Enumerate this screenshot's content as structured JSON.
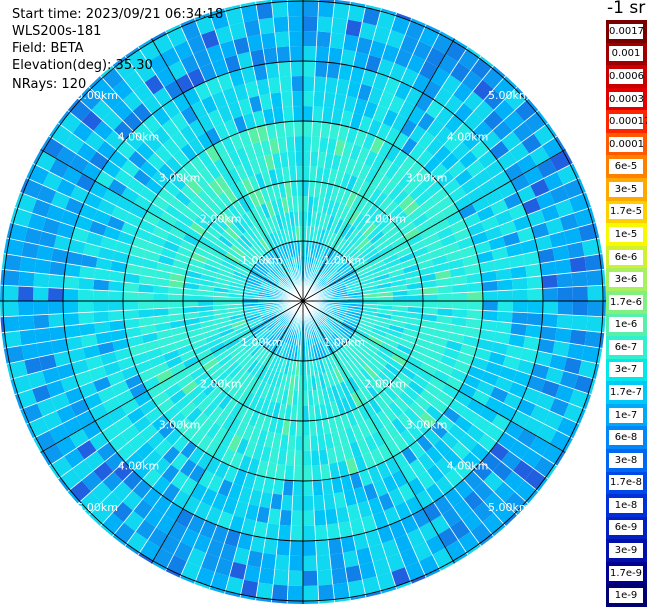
{
  "info": {
    "start_time": "Start time: 2023/09/21 06:34:18",
    "instrument": "WLS200s-181",
    "field": "Field: BETA",
    "elevation": "Elevation(deg): 35.30",
    "nrays": "NRays: 120"
  },
  "colorbar": {
    "title": "-1 sr",
    "labels": [
      "0.0017",
      "0.001",
      "0.0006",
      "0.0003",
      "0.00017",
      "0.0001",
      "6e-5",
      "3e-5",
      "1.7e-5",
      "1e-5",
      "6e-6",
      "3e-6",
      "1.7e-6",
      "1e-6",
      "6e-7",
      "3e-7",
      "1.7e-7",
      "1e-7",
      "6e-8",
      "3e-8",
      "1.7e-8",
      "1e-8",
      "6e-9",
      "3e-9",
      "1.7e-9",
      "1e-9"
    ],
    "colors": [
      "#7a0000",
      "#9e0000",
      "#c80000",
      "#e10000",
      "#ff2400",
      "#ff5a00",
      "#ff8000",
      "#ffa800",
      "#ffd000",
      "#f8f800",
      "#d0f030",
      "#a8f060",
      "#80f080",
      "#58f0a8",
      "#30f0d0",
      "#00e8e8",
      "#00c8f8",
      "#00a8f8",
      "#0088f8",
      "#0068f0",
      "#0048e8",
      "#0030d8",
      "#0020c0",
      "#0010a8",
      "#000090",
      "#000070"
    ]
  },
  "chart_data": {
    "type": "heatmap",
    "projection": "polar (PPI scan)",
    "field": "BETA",
    "unit": "sr-1",
    "elevation_deg": 35.3,
    "n_rays": 120,
    "range_rings_km": [
      1,
      2,
      3,
      4,
      5
    ],
    "range_ring_labels": [
      "1.00km",
      "2.00km",
      "3.00km",
      "4.00km",
      "5.00km"
    ],
    "azimuth_spokes_deg": [
      0,
      30,
      60,
      90,
      120,
      150,
      180,
      210,
      240,
      270,
      300,
      330
    ],
    "max_range_km": 5.05,
    "color_scale": "log",
    "value_range": [
      1e-09,
      0.0017
    ],
    "typical_values_by_range": {
      "0-1km": "6e-8",
      "1-3km": "3e-7",
      "3-4km": "1.7e-7",
      "4-5km": "6e-8"
    }
  }
}
